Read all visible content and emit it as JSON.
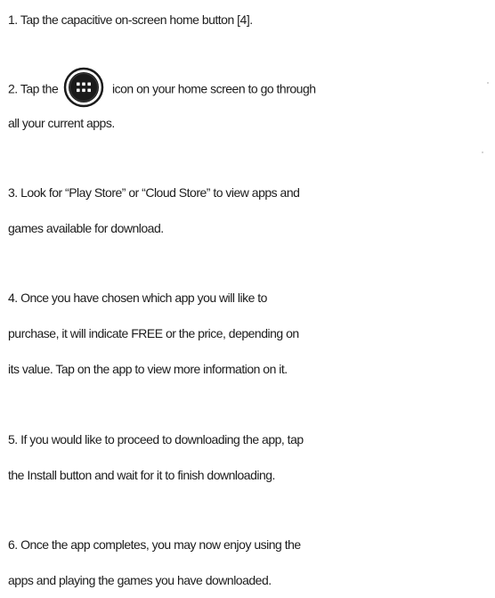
{
  "steps": [
    {
      "lines": [
        "1. Tap the capacitive on-screen home button [4]."
      ]
    },
    {
      "before_icon": "2. Tap the",
      "icon": "apps-grid-icon",
      "after_icon": "icon on your home screen to go through",
      "lines": [
        "all your current apps."
      ]
    },
    {
      "lines": [
        "3. Look for “Play Store” or “Cloud Store” to view apps and",
        "games available for download."
      ]
    },
    {
      "lines": [
        "4. Once you have chosen which app you will like to",
        "purchase, it will indicate FREE or the price, depending on",
        "its value. Tap on the app to view more information on it."
      ]
    },
    {
      "lines": [
        "5. If you would like to proceed to downloading the app, tap",
        "the Install button and wait for it to finish downloading."
      ]
    },
    {
      "lines": [
        "6. Once the app completes, you may now enjoy using the",
        "apps and playing the games you have downloaded."
      ]
    }
  ],
  "colors": {
    "text": "#1c1c1c",
    "icon_ring": "#1a1a1a",
    "icon_dots": "#ffffff",
    "background": "#ffffff"
  }
}
